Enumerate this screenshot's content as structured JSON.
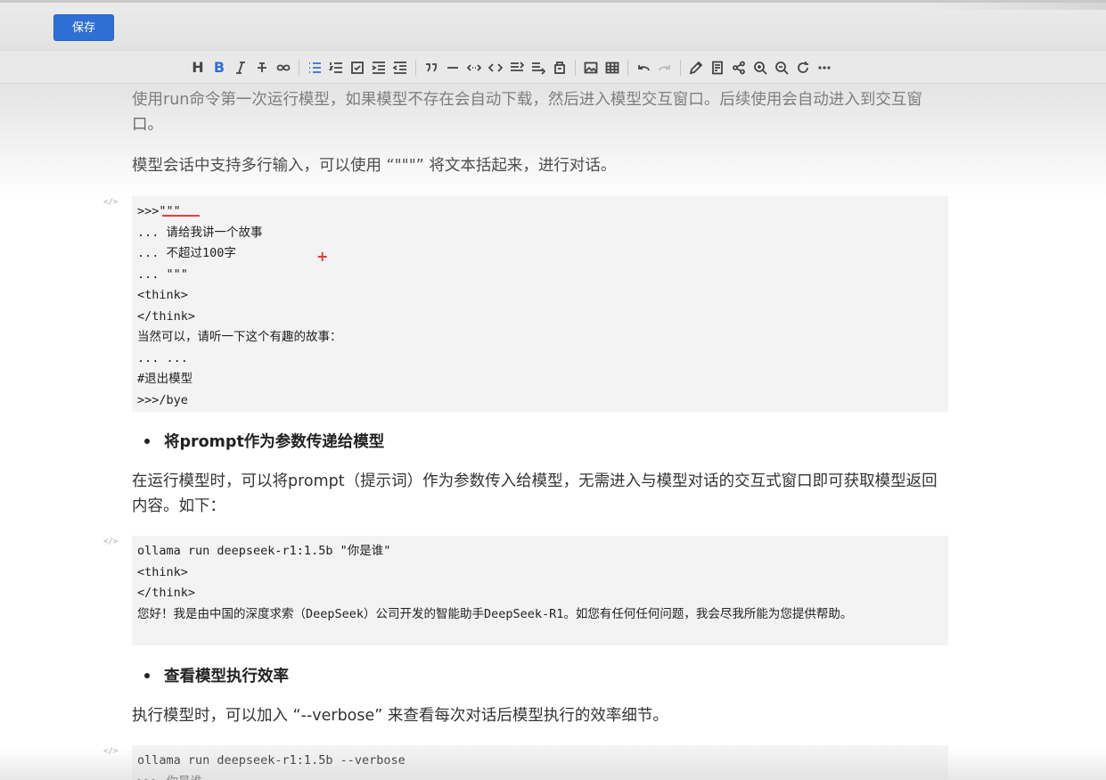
{
  "header": {
    "save_label": "保存"
  },
  "toolbar": {
    "items": [
      "heading",
      "bold",
      "italic",
      "strikethrough",
      "link",
      "unordered-list",
      "ordered-list",
      "task-list",
      "indent",
      "outdent",
      "quote",
      "horizontal-rule",
      "inline-code",
      "code-block",
      "toc",
      "align",
      "insert-file",
      "image",
      "table",
      "undo",
      "redo",
      "edit",
      "preview",
      "share",
      "zoom-in",
      "zoom-out",
      "refresh",
      "more"
    ],
    "heading_label": "H",
    "bold_label": "B"
  },
  "doc": {
    "p1": "使用run命令第一次运行模型，如果模型不存在会自动下载，然后进入模型交互窗口。后续使用会自动进入到交互窗口。",
    "p2": "模型会话中支持多行输入，可以使用 “\"\"\"” 将文本括起来，进行对话。",
    "code1": [
      ">>>\"\"\"",
      "... 请给我讲一个故事",
      "... 不超过100字",
      "... \"\"\"",
      "<think>",
      "</think>",
      "当然可以，请听一下这个有趣的故事：",
      "... ...",
      "#退出模型",
      ">>>/bye"
    ],
    "bullet1": "将prompt作为参数传递给模型",
    "p3": "在运行模型时，可以将prompt（提示词）作为参数传入给模型，无需进入与模型对话的交互式窗口即可获取模型返回内容。如下：",
    "code2": [
      "ollama run deepseek-r1:1.5b \"你是谁\"",
      "<think>",
      "</think>",
      "您好！我是由中国的深度求索（DeepSeek）公司开发的智能助手DeepSeek-R1。如您有任何任何问题，我会尽我所能为您提供帮助。"
    ],
    "bullet2": "查看模型执行效率",
    "p4": "执行模型时，可以加入 “--verbose” 来查看每次对话后模型执行的效率细节。",
    "code3": [
      "ollama run deepseek-r1:1.5b --verbose",
      ">>> 你是谁"
    ],
    "code_marker": "</>",
    "cursor_mark": "+"
  },
  "colors": {
    "accent": "#2f6fd3",
    "code_bg": "#f3f3f3",
    "highlight": "#e34040"
  }
}
